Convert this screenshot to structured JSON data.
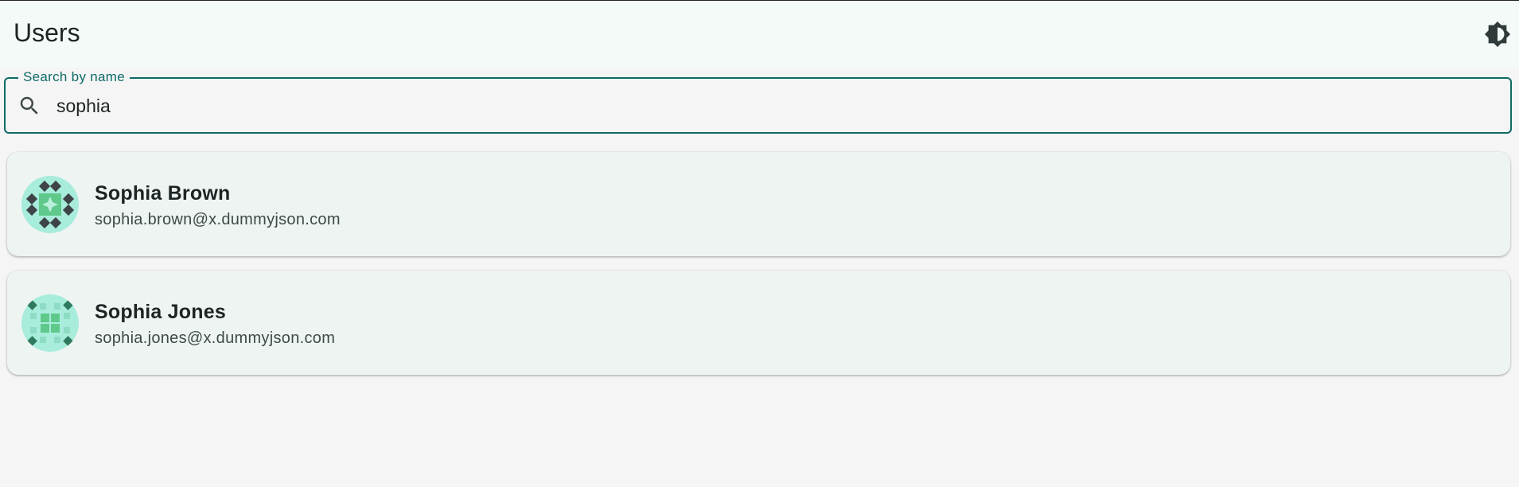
{
  "app_bar": {
    "title": "Users",
    "theme_toggle_icon": "brightness-contrast-icon"
  },
  "search": {
    "label": "Search by name",
    "value": "sophia",
    "icon": "search-icon"
  },
  "users": [
    {
      "name": "Sophia Brown",
      "email": "sophia.brown@x.dummyjson.com",
      "avatar": "identicon-avatar"
    },
    {
      "name": "Sophia Jones",
      "email": "sophia.jones@x.dummyjson.com",
      "avatar": "identicon-avatar"
    }
  ],
  "colors": {
    "accent": "#0f6b66",
    "app_bar_bg": "#f3faf8",
    "card_bg": "#eef4f2",
    "avatar_bg": "#a8ecdc"
  }
}
